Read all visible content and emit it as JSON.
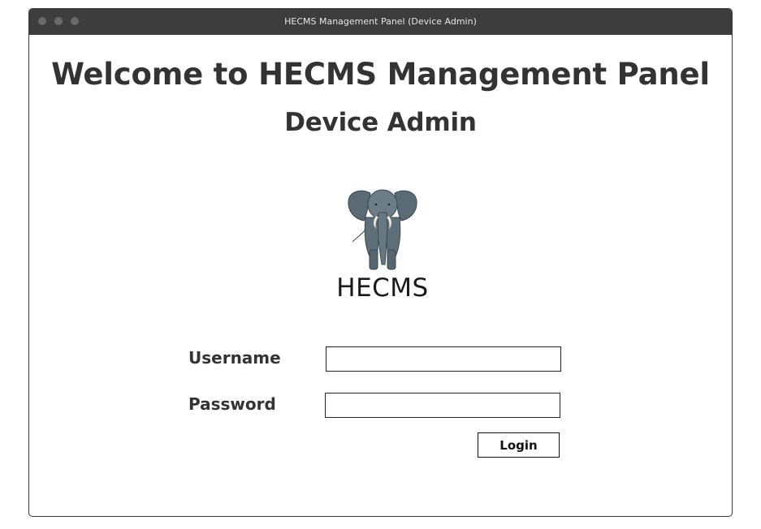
{
  "window": {
    "title": "HECMS Management Panel (Device Admin)"
  },
  "header": {
    "heading": "Welcome to HECMS Management Panel",
    "subheading": "Device Admin"
  },
  "logo": {
    "icon": "elephant-icon",
    "text": "HECMS"
  },
  "form": {
    "username_label": "Username",
    "username_value": "",
    "password_label": "Password",
    "password_value": "",
    "login_label": "Login"
  }
}
